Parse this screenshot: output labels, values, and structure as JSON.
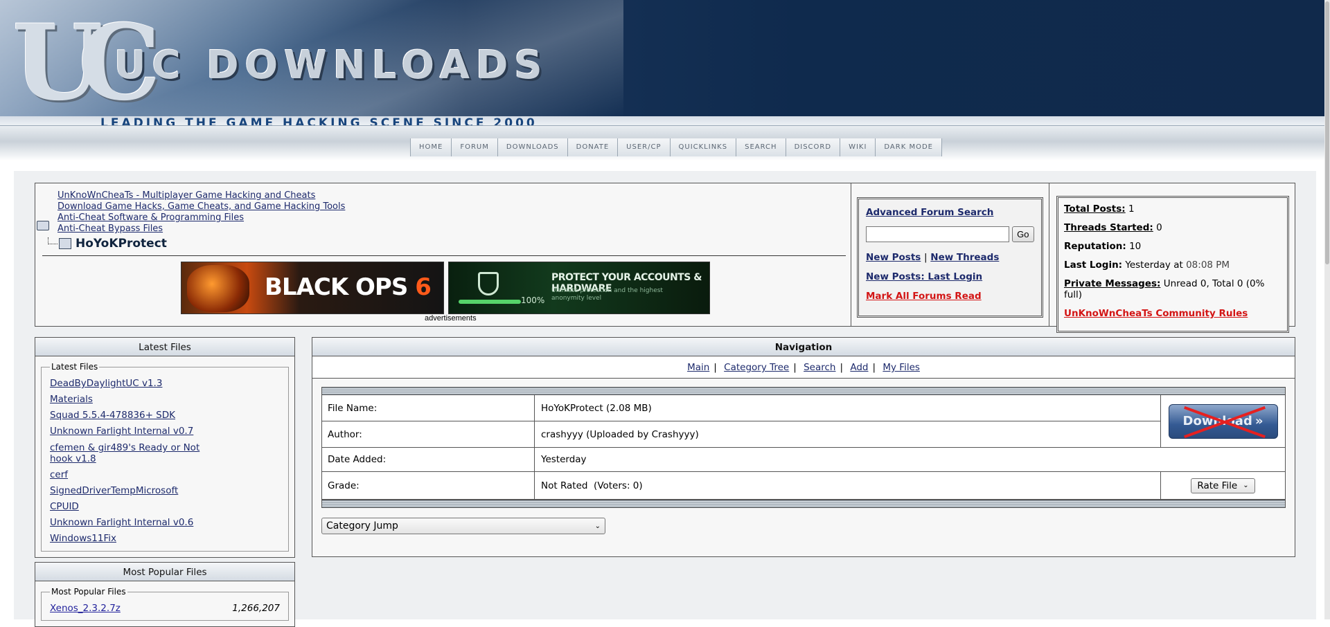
{
  "header": {
    "logo_mark": "UC",
    "title": "UC DOWNLOADS",
    "tagline": "LEADING THE GAME HACKING SCENE SINCE 2000"
  },
  "nav": [
    "HOME",
    "FORUM",
    "DOWNLOADS",
    "DONATE",
    "USER/CP",
    "QUICKLINKS",
    "SEARCH",
    "DISCORD",
    "WIKI",
    "DARK MODE"
  ],
  "breadcrumbs": [
    "UnKnoWnCheaTs - Multiplayer Game Hacking and Cheats",
    "Download Game Hacks, Game Cheats, and Game Hacking Tools",
    "Anti-Cheat Software & Programming Files",
    "Anti-Cheat Bypass Files"
  ],
  "current_page": "HoYoKProtect",
  "ads": {
    "ad1_text": "BLACK OPS",
    "ad1_num": "6",
    "ad2_title": "PROTECT YOUR ACCOUNTS & HARDWARE",
    "ad2_sub": "Ultimate protection and the highest anonymity level",
    "ad2_pct": "100%",
    "caption": "advertisements"
  },
  "search_box": {
    "advanced": "Advanced Forum Search",
    "go": "Go",
    "new_posts": "New Posts",
    "separator": "|",
    "new_threads": "New Threads",
    "new_posts_last_login": "New Posts: Last Login",
    "mark_read": "Mark All Forums Read"
  },
  "stats": {
    "total_posts_label": "Total Posts:",
    "total_posts": "1",
    "threads_label": "Threads Started:",
    "threads": "0",
    "rep_label": "Reputation:",
    "rep": "10",
    "login_label": "Last Login:",
    "login_day": "Yesterday at",
    "login_time": "08:08 PM",
    "pm_label": "Private Messages:",
    "pm": "Unread 0, Total 0 (0% full)",
    "rules": "UnKnoWnCheaTs Community Rules"
  },
  "latest": {
    "head": "Latest Files",
    "legend": "Latest Files",
    "items": [
      "DeadByDaylightUC v1.3",
      "Materials",
      "Squad 5.5.4-478836+ SDK",
      "Unknown Farlight Internal v0.7",
      "cfemen & gir489's Ready or Not hook v1.8",
      "cerf",
      "SignedDriverTempMicrosoft",
      "CPUID",
      "Unknown Farlight Internal v0.6",
      "Windows11Fix"
    ]
  },
  "popular": {
    "head": "Most Popular Files",
    "legend": "Most Popular Files",
    "items": [
      {
        "name": "Xenos_2.3.2.7z",
        "count": "1,266,207"
      }
    ]
  },
  "navigation": {
    "head": "Navigation",
    "links": [
      "Main",
      "Category Tree",
      "Search",
      "Add",
      "My Files"
    ],
    "separator": "|"
  },
  "file": {
    "name_label": "File Name:",
    "name_value": "HoYoKProtect (2.08 MB)",
    "author_label": "Author:",
    "author_value": "crashyyy (Uploaded by Crashyyy)",
    "date_label": "Date Added:",
    "date_value": "Yesterday",
    "grade_label": "Grade:",
    "grade_value": "Not Rated  (Voters: 0)",
    "download": "Download",
    "rate": "Rate File",
    "category_jump": "Category Jump"
  }
}
